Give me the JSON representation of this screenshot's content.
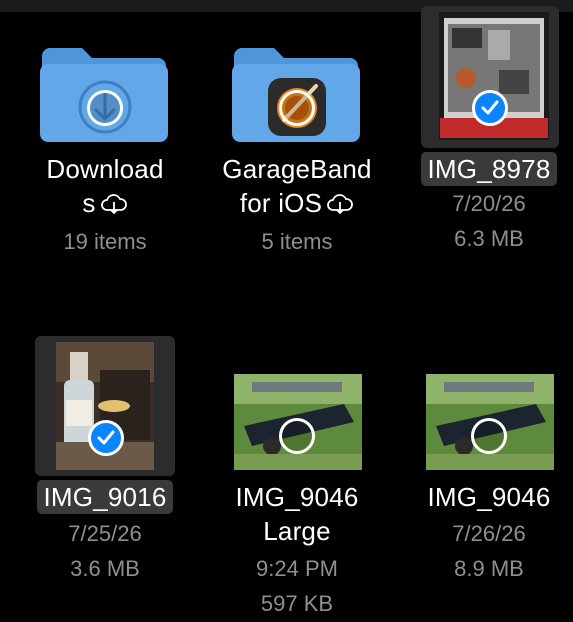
{
  "items": [
    {
      "name_line1": "Download",
      "name_line2": "s",
      "count": "19 items",
      "type": "folder",
      "badge_icon": "download-icon",
      "cloud_icon": "icloud-download-icon"
    },
    {
      "name_line1": "GarageBand",
      "name_line2": "for iOS",
      "count": "5 items",
      "type": "folder",
      "badge_icon": "garageband-app-icon",
      "cloud_icon": "icloud-download-icon"
    },
    {
      "name": "IMG_8978",
      "date": "7/20/26",
      "size": "6.3 MB",
      "type": "image",
      "selected": true
    },
    {
      "name": "IMG_9016",
      "date": "7/25/26",
      "size": "3.6 MB",
      "type": "image",
      "selected": true
    },
    {
      "name_line1": "IMG_9046",
      "name_line2": "Large",
      "date": "9:24 PM",
      "size": "597 KB",
      "type": "image",
      "selected": false
    },
    {
      "name": "IMG_9046",
      "date": "7/26/26",
      "size": "8.9 MB",
      "type": "image",
      "selected": false
    }
  ],
  "colors": {
    "background": "#000000",
    "folder": "#62a7e8",
    "folder_tab": "#4f95da",
    "accent": "#0a84ff",
    "secondary_text": "#8e8e93"
  }
}
